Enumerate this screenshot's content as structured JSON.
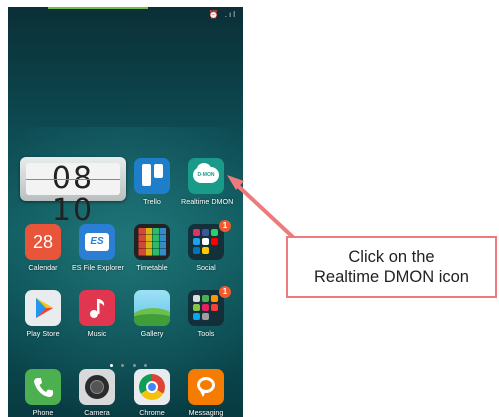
{
  "status": {
    "icons_text": "⏰ .ıl"
  },
  "clock": {
    "time": "08 10"
  },
  "apps_row1": [
    {
      "label": "Trello",
      "icon": "trello-icon"
    },
    {
      "label": "Realtime DMON",
      "icon": "realtime-dmon-icon",
      "icon_text": "D-MON"
    }
  ],
  "apps_row2": [
    {
      "label": "Calendar",
      "icon": "calendar-icon",
      "icon_text": "28"
    },
    {
      "label": "ES File Explorer",
      "icon": "es-file-explorer-icon",
      "icon_text": "ES"
    },
    {
      "label": "Timetable",
      "icon": "timetable-icon"
    },
    {
      "label": "Social",
      "icon": "social-folder-icon",
      "badge": "1"
    }
  ],
  "apps_row3": [
    {
      "label": "Play Store",
      "icon": "play-store-icon"
    },
    {
      "label": "Music",
      "icon": "music-icon"
    },
    {
      "label": "Gallery",
      "icon": "gallery-icon"
    },
    {
      "label": "Tools",
      "icon": "tools-folder-icon",
      "badge": "1"
    }
  ],
  "dock": [
    {
      "label": "Phone",
      "icon": "phone-icon"
    },
    {
      "label": "Camera",
      "icon": "camera-icon"
    },
    {
      "label": "Chrome",
      "icon": "chrome-icon"
    },
    {
      "label": "Messaging",
      "icon": "messaging-icon"
    }
  ],
  "callout": {
    "line1": "Click on the",
    "line2": "Realtime DMON icon"
  },
  "colors": {
    "callout_border": "#ee7b7b",
    "arrow": "#ee7b7b",
    "wallpaper": "#0d4a52"
  }
}
